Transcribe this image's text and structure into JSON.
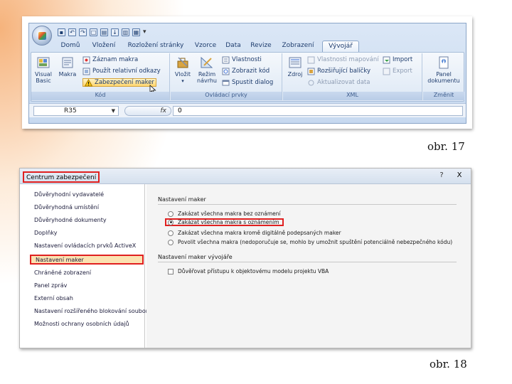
{
  "excel": {
    "tabs": [
      "Domů",
      "Vložení",
      "Rozložení stránky",
      "Vzorce",
      "Data",
      "Revize",
      "Zobrazení",
      "Vývojář"
    ],
    "active_tab": "Vývojář",
    "groups": {
      "kod": {
        "label": "Kód",
        "visual_basic": "Visual Basic",
        "makra": "Makra",
        "zaznam_makra": "Záznam makra",
        "relativni_odkazy": "Použít relativní odkazy",
        "zabezpeceni_maker": "Zabezpečení maker"
      },
      "ovladaci": {
        "label": "Ovládací prvky",
        "vlozit": "Vložit",
        "rezim_navrhu": "Režim návrhu",
        "vlastnosti": "Vlastnosti",
        "zobrazit_kod": "Zobrazit kód",
        "spustit_dialog": "Spustit dialog"
      },
      "xml": {
        "label": "XML",
        "zdroj": "Zdroj",
        "vlastnosti_mapovani": "Vlastnosti mapování",
        "rozsirujici_balicky": "Rozšiřující balíčky",
        "aktualizovat_data": "Aktualizovat data",
        "import": "Import",
        "export": "Export"
      },
      "zmenit": {
        "label": "Změnit",
        "panel_dokumentu": "Panel dokumentu"
      }
    },
    "name_box": "R35",
    "fx": "fx",
    "formula_value": "0"
  },
  "captions": {
    "fig17": "obr. 17",
    "fig18": "obr. 18"
  },
  "trust": {
    "title": "Centrum zabezpečení",
    "help": "?",
    "close": "X",
    "nav": [
      "Důvěryhodní vydavatelé",
      "Důvěryhodná umístění",
      "Důvěryhodné dokumenty",
      "Doplňky",
      "Nastavení ovládacích prvků ActiveX",
      "Nastavení maker",
      "Chráněné zobrazení",
      "Panel zpráv",
      "Externí obsah",
      "Nastavení rozšířeného blokování souborů",
      "Možnosti ochrany osobních údajů"
    ],
    "selected_nav": "Nastavení maker",
    "section1": "Nastavení maker",
    "options": [
      "Zakázat všechna makra bez oznámení",
      "Zakázat všechna makra s oznámením",
      "Zakázat všechna makra kromě digitálně podepsaných maker",
      "Povolit všechna makra (nedoporučuje se, mohlo by umožnit spuštění potenciálně nebezpečného kódu)"
    ],
    "selected_option": "Zakázat všechna makra s oznámením",
    "section2": "Nastavení maker vývojáře",
    "vba_checkbox": "Důvěřovat přístupu k objektovému modelu projektu VBA"
  },
  "colors": {
    "highlight_red": "#e02020",
    "selected_bg": "#fbe2b1",
    "ribbon_blue": "#dbe7f6",
    "accent_orange": "#f6b37c"
  }
}
